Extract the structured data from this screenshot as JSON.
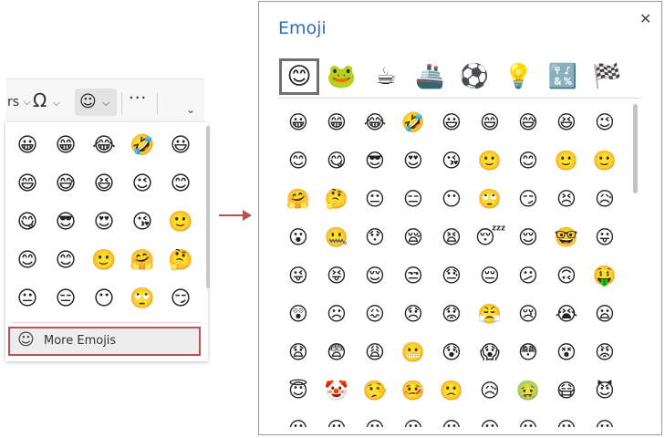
{
  "toolbar": {
    "overflow_text": "rs",
    "omega": "Ω",
    "emoji_button_face": "☺",
    "more": "···",
    "collapse": "⌄"
  },
  "dropdown": {
    "emojis": [
      "😀",
      "😁",
      "😂",
      "🤣",
      "😃",
      "😄",
      "😅",
      "😆",
      "😉",
      "😊",
      "😋",
      "😎",
      "😍",
      "😘",
      "🙂",
      "😊",
      "😊",
      "🙂",
      "🤗",
      "🤔",
      "😐",
      "😑",
      "😶",
      "🙄",
      "😏"
    ],
    "more_emojis_label": "More Emojis"
  },
  "panel": {
    "title": "Emoji",
    "close": "✕",
    "categories": [
      "😊",
      "🐸",
      "☕",
      "🚢",
      "⚽",
      "💡",
      "🔣",
      "🏁"
    ],
    "grid": [
      "😀",
      "😁",
      "😂",
      "🤣",
      "😃",
      "😄",
      "😅",
      "😆",
      "😉",
      "😊",
      "😋",
      "😎",
      "😍",
      "😘",
      "🙂",
      "😊",
      "🙂",
      "🙂",
      "🤗",
      "🤔",
      "😐",
      "😑",
      "😶",
      "🙄",
      "😏",
      "😣",
      "😥",
      "😮",
      "🤐",
      "😯",
      "😪",
      "😫",
      "😴",
      "😌",
      "🤓",
      "😛",
      "😜",
      "😝",
      "😌",
      "😒",
      "😓",
      "😔",
      "😕",
      "🙃",
      "🤑",
      "😲",
      "☹",
      "😖",
      "😞",
      "😟",
      "😤",
      "😢",
      "😭",
      "😦",
      "😧",
      "😨",
      "😩",
      "😬",
      "😰",
      "😱",
      "😳",
      "😵",
      "😡",
      "😇",
      "🤡",
      "🤥",
      "🤒",
      "🙁",
      "😥",
      "🤢",
      "😷",
      "😈"
    ],
    "partial_row": [
      "😐",
      "😐",
      "😐",
      "😐",
      "😐",
      "😐",
      "😐",
      "😐",
      "😐"
    ]
  },
  "arrow_color": "#c0504d"
}
